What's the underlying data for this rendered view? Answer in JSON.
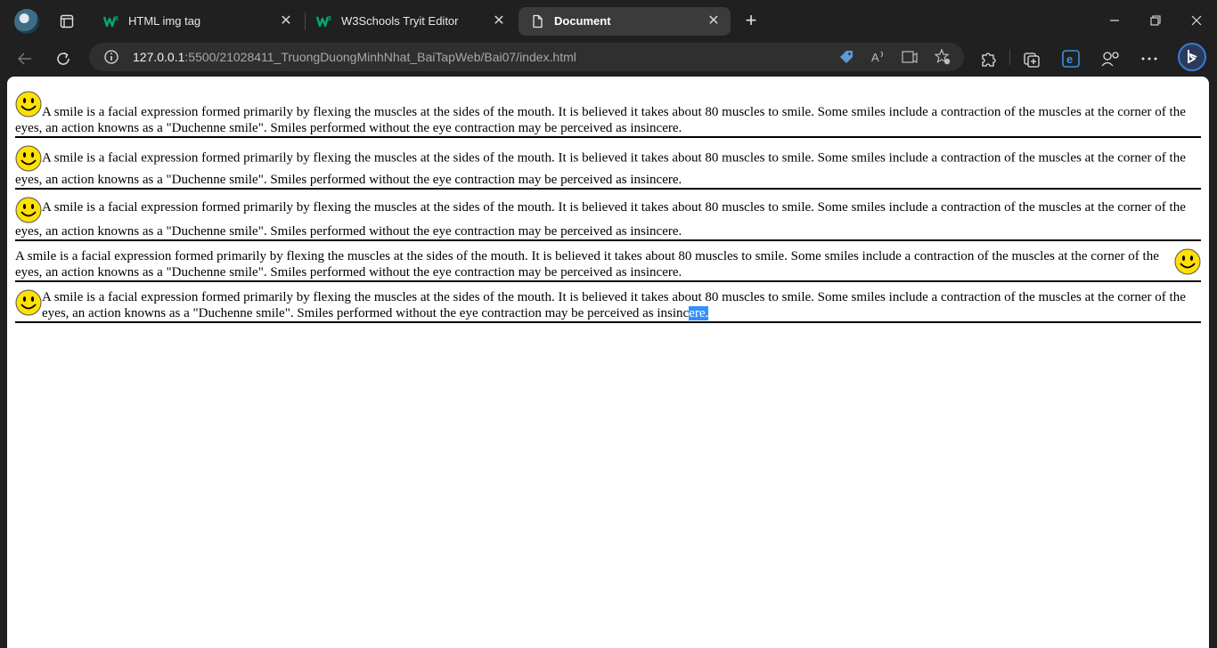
{
  "browser": {
    "tabs": [
      {
        "title": "HTML img tag",
        "favicon": "w3schools-icon",
        "active": false
      },
      {
        "title": "W3Schools Tryit Editor",
        "favicon": "w3schools-icon",
        "active": false
      },
      {
        "title": "Document",
        "favicon": "page-icon",
        "active": true
      }
    ],
    "address": {
      "host": "127.0.0.1",
      "path": ":5500/21028411_TruongDuongMinhNhat_BaiTapWeb/Bai07/index.html"
    },
    "colors": {
      "chrome": "#202020",
      "active_tab": "#3b3b3b",
      "address_bar": "#2f2f2f",
      "selection": "#3390ff"
    }
  },
  "page": {
    "paragraph_text": "A smile is a facial expression formed primarily by flexing the muscles at the sides of the mouth. It is believed it takes about 80 muscles to smile. Some smiles include a contraction of the muscles at the corner of the eyes, an action knowns as a \"Duchenne smile\". Smiles performed without the eye contraction may be perceived as insincere.",
    "last_paragraph_text": "A smile is a facial expression formed primarily by flexing the muscles at the sides of the mouth. It is believed it takes about 80 muscles to smile. Some smiles include a contraction of the muscles at the corner of the eyes, an action knowns as a \"Duchenne smile\". Smiles performed without the eye contraction may be perceived as insinc",
    "selected_text": "ere.",
    "image_alignments": [
      "default",
      "middle",
      "bottom",
      "right",
      "left"
    ],
    "image_icon": "smiley-face-icon"
  }
}
